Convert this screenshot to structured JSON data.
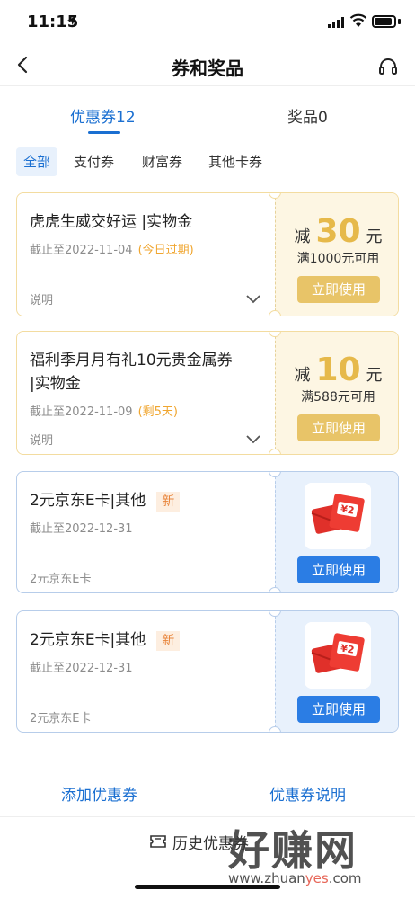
{
  "status_bar": {
    "time": "11:15"
  },
  "nav": {
    "title": "券和奖品"
  },
  "tabs": [
    {
      "label": "优惠券12",
      "active": true
    },
    {
      "label": "奖品0",
      "active": false
    }
  ],
  "filters": [
    "全部",
    "支付券",
    "财富券",
    "其他卡券"
  ],
  "coupons": [
    {
      "title": "虎虎生威交好运 |实物金",
      "expire": "截止至2022-11-04",
      "expire_note": "(今日过期)",
      "desc": "说明",
      "amount_prefix": "减",
      "amount": "30",
      "amount_unit": "元",
      "condition": "满1000元可用",
      "button": "立即使用"
    },
    {
      "title_line1": "福利季月月有礼10元贵金属券",
      "title_line2": "|实物金",
      "expire": "截止至2022-11-09",
      "expire_note": "(剩5天)",
      "desc": "说明",
      "amount_prefix": "减",
      "amount": "10",
      "amount_unit": "元",
      "condition": "满588元可用",
      "button": "立即使用"
    },
    {
      "title": "2元京东E卡|其他",
      "badge": "新",
      "expire": "截止至2022-12-31",
      "desc": "2元京东E卡",
      "button": "立即使用"
    },
    {
      "title": "2元京东E卡|其他",
      "badge": "新",
      "expire": "截止至2022-12-31",
      "desc": "2元京东E卡",
      "button": "立即使用"
    }
  ],
  "bottom_links": {
    "add": "添加优惠券",
    "explain": "优惠券说明"
  },
  "history": "历史优惠券",
  "watermark": {
    "main": "好赚网",
    "sub_pre": "www.zhuan",
    "sub_hl": "yes",
    "sub_post": ".com"
  },
  "colors": {
    "accent": "#1a6fd1",
    "gold": "#e8c468",
    "gold_amount": "#e6b94a",
    "button_blue": "#2b7de4",
    "warn": "#f0a630"
  },
  "icons": [
    "back-icon",
    "headset-icon",
    "chevron-down-icon",
    "red-envelope-icon",
    "ticket-icon"
  ]
}
